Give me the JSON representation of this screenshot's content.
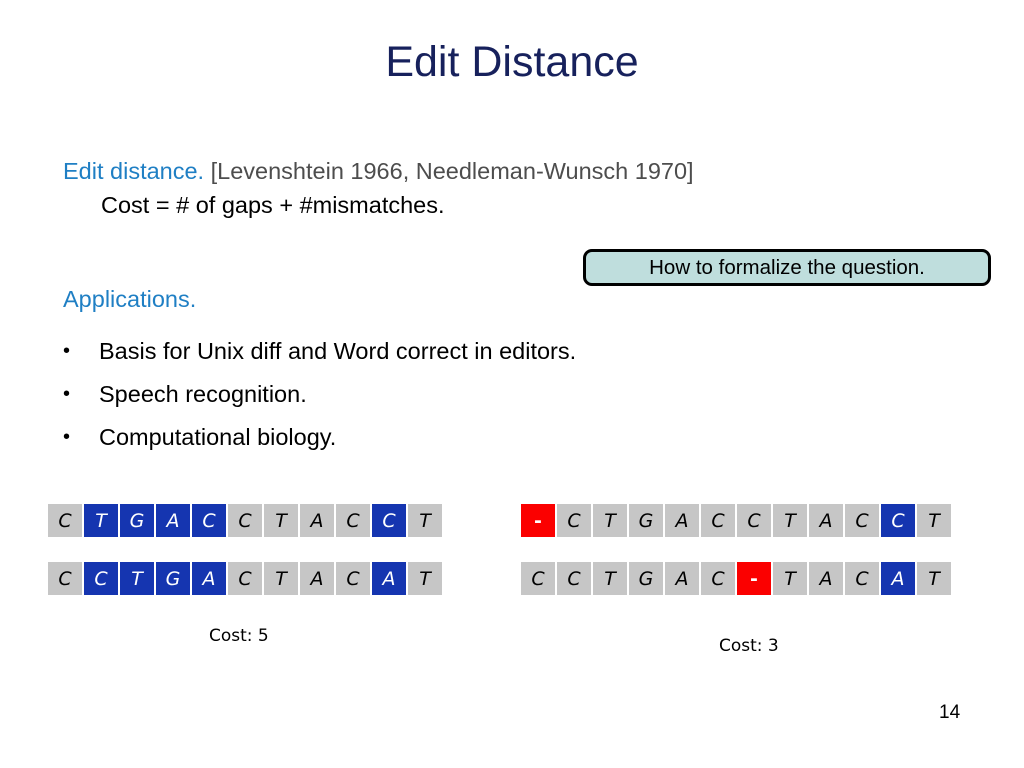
{
  "slide": {
    "title": "Edit Distance",
    "page_number": "14"
  },
  "definition": {
    "lead": "Edit distance.",
    "citation": "[Levenshtein 1966, Needleman-Wunsch 1970]",
    "cost_line": "Cost = # of gaps + #mismatches."
  },
  "callout": {
    "text": "How to formalize the question."
  },
  "applications": {
    "heading": "Applications.",
    "bullet_marker": "•",
    "items": [
      "Basis for Unix diff and Word correct in editors.",
      "Speech recognition.",
      "Computational biology."
    ]
  },
  "colors": {
    "title_navy": "#17215c",
    "accent_blue": "#1f7fc4",
    "cell_blue": "#1535b0",
    "cell_gray": "#c6c6c6",
    "cell_red": "#fb0000",
    "callout_fill": "#bfdedd",
    "citation_gray": "#4d4d4d"
  },
  "alignments": [
    {
      "id": "left-alignment",
      "cost_label": "Cost: 5",
      "rows": [
        {
          "id": "left-top-row",
          "cells": [
            {
              "ch": "C",
              "state": "gray"
            },
            {
              "ch": "T",
              "state": "blue"
            },
            {
              "ch": "G",
              "state": "blue"
            },
            {
              "ch": "A",
              "state": "blue"
            },
            {
              "ch": "C",
              "state": "blue"
            },
            {
              "ch": "C",
              "state": "gray"
            },
            {
              "ch": "T",
              "state": "gray"
            },
            {
              "ch": "A",
              "state": "gray"
            },
            {
              "ch": "C",
              "state": "gray"
            },
            {
              "ch": "C",
              "state": "blue"
            },
            {
              "ch": "T",
              "state": "gray"
            }
          ]
        },
        {
          "id": "left-bottom-row",
          "cells": [
            {
              "ch": "C",
              "state": "gray"
            },
            {
              "ch": "C",
              "state": "blue"
            },
            {
              "ch": "T",
              "state": "blue"
            },
            {
              "ch": "G",
              "state": "blue"
            },
            {
              "ch": "A",
              "state": "blue"
            },
            {
              "ch": "C",
              "state": "gray"
            },
            {
              "ch": "T",
              "state": "gray"
            },
            {
              "ch": "A",
              "state": "gray"
            },
            {
              "ch": "C",
              "state": "gray"
            },
            {
              "ch": "A",
              "state": "blue"
            },
            {
              "ch": "T",
              "state": "gray"
            }
          ]
        }
      ]
    },
    {
      "id": "right-alignment",
      "cost_label": "Cost: 3",
      "rows": [
        {
          "id": "right-top-row",
          "cells": [
            {
              "ch": "-",
              "state": "red"
            },
            {
              "ch": "C",
              "state": "gray"
            },
            {
              "ch": "T",
              "state": "gray"
            },
            {
              "ch": "G",
              "state": "gray"
            },
            {
              "ch": "A",
              "state": "gray"
            },
            {
              "ch": "C",
              "state": "gray"
            },
            {
              "ch": "C",
              "state": "gray"
            },
            {
              "ch": "T",
              "state": "gray"
            },
            {
              "ch": "A",
              "state": "gray"
            },
            {
              "ch": "C",
              "state": "gray"
            },
            {
              "ch": "C",
              "state": "blue"
            },
            {
              "ch": "T",
              "state": "gray"
            }
          ]
        },
        {
          "id": "right-bottom-row",
          "cells": [
            {
              "ch": "C",
              "state": "gray"
            },
            {
              "ch": "C",
              "state": "gray"
            },
            {
              "ch": "T",
              "state": "gray"
            },
            {
              "ch": "G",
              "state": "gray"
            },
            {
              "ch": "A",
              "state": "gray"
            },
            {
              "ch": "C",
              "state": "gray"
            },
            {
              "ch": "-",
              "state": "red"
            },
            {
              "ch": "T",
              "state": "gray"
            },
            {
              "ch": "A",
              "state": "gray"
            },
            {
              "ch": "C",
              "state": "gray"
            },
            {
              "ch": "A",
              "state": "blue"
            },
            {
              "ch": "T",
              "state": "gray"
            }
          ]
        }
      ]
    }
  ]
}
